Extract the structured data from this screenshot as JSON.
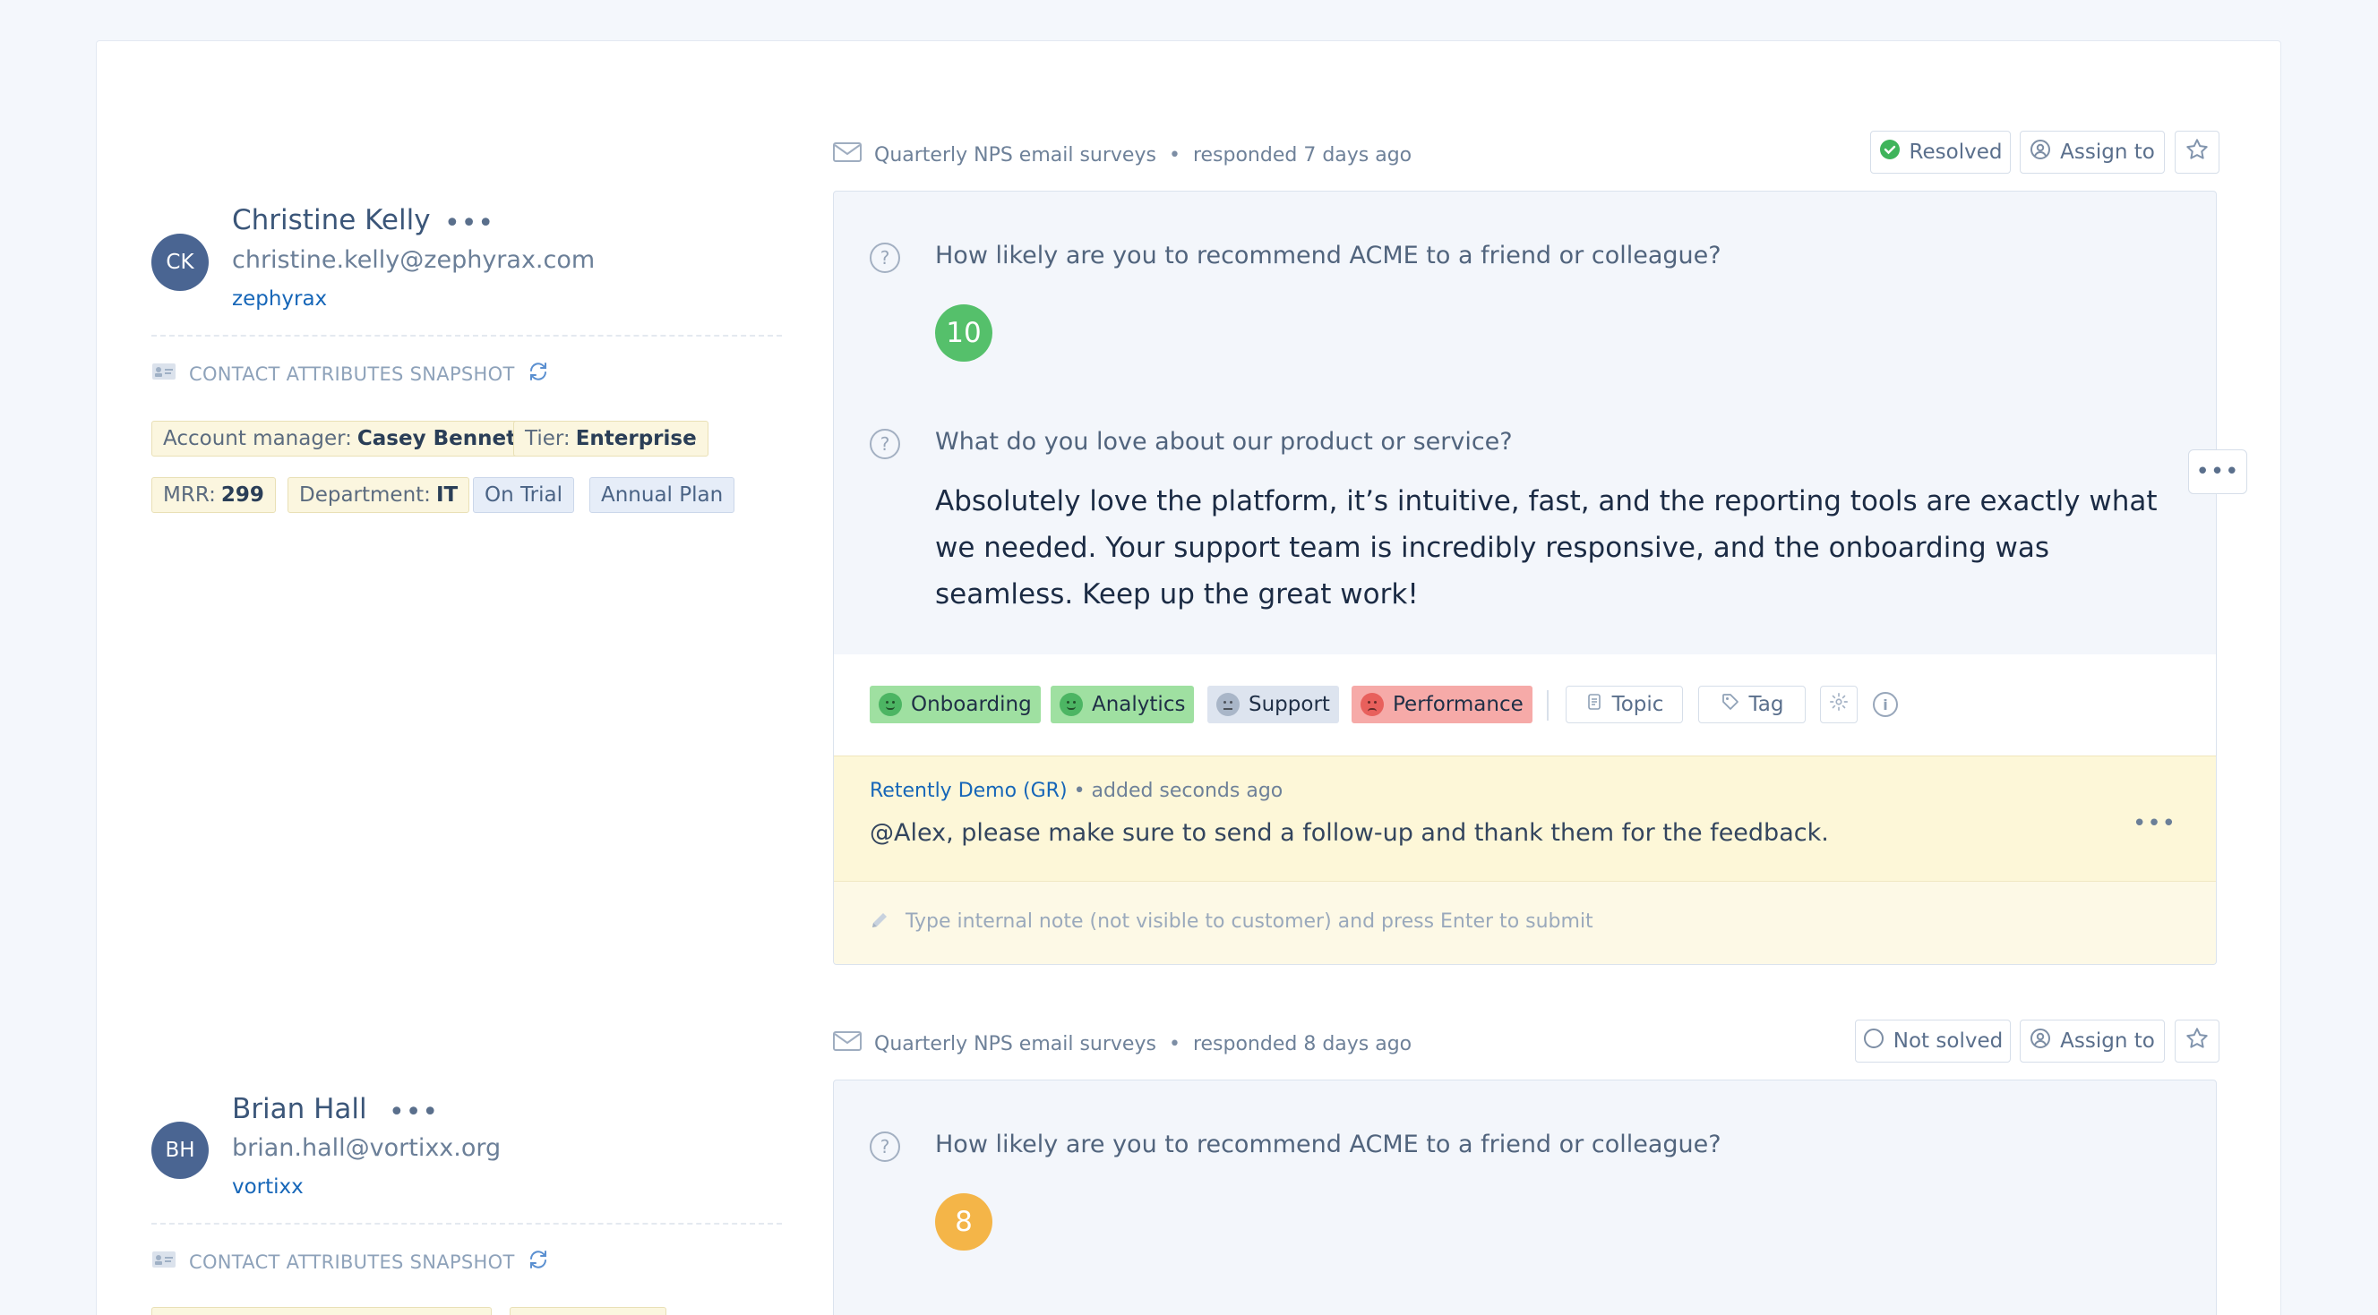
{
  "contacts": [
    {
      "initials": "CK",
      "name": "Christine Kelly",
      "email": "christine.kelly@zephyrax.com",
      "company": "zephyrax",
      "more": "•••",
      "snapshot_label": "CONTACT ATTRIBUTES SNAPSHOT",
      "attributes": [
        {
          "key": "Account manager:",
          "value": "Casey Bennett"
        },
        {
          "key": "Tier:",
          "value": "Enterprise"
        },
        {
          "key": "MRR:",
          "value": "299"
        },
        {
          "key": "Department:",
          "value": "IT"
        }
      ],
      "tags": [
        "On Trial",
        "Annual Plan"
      ]
    },
    {
      "initials": "BH",
      "name": "Brian Hall",
      "email": "brian.hall@vortixx.org",
      "company": "vortixx",
      "more": "•••",
      "snapshot_label": "CONTACT ATTRIBUTES SNAPSHOT"
    }
  ],
  "responses": [
    {
      "channel": "Quarterly NPS email surveys",
      "separator": "•",
      "responded": "responded 7 days ago",
      "status_label": "Resolved",
      "assign_label": "Assign to",
      "question1": "How likely are you to recommend ACME to a friend or colleague?",
      "score": "10",
      "question2": "What do you love about our product or service?",
      "answer": "Absolutely love the platform, it’s intuitive, fast, and the reporting tools are exactly what we needed. Your support team is incredibly responsive, and the onboarding was seamless. Keep up the great work!",
      "topics": [
        {
          "label": "Onboarding",
          "sentiment": "positive"
        },
        {
          "label": "Analytics",
          "sentiment": "positive"
        },
        {
          "label": "Support",
          "sentiment": "neutral"
        },
        {
          "label": "Performance",
          "sentiment": "negative"
        }
      ],
      "topic_button": "Topic",
      "tag_button": "Tag",
      "note": {
        "author": "Retently Demo (GR)",
        "time": "• added seconds ago",
        "text": "@Alex, please make sure to send a follow-up and thank them for the feedback."
      },
      "note_placeholder": "Type internal note (not visible to customer) and press Enter to submit"
    },
    {
      "channel": "Quarterly NPS email surveys",
      "separator": "•",
      "responded": "responded 8 days ago",
      "status_label": "Not solved",
      "assign_label": "Assign to",
      "question1": "How likely are you to recommend ACME to a friend or colleague?",
      "score": "8"
    }
  ],
  "colors": {
    "score_promoter": "#55c06b",
    "score_passive": "#f4b548",
    "positive": "#9fe0a1",
    "neutral": "#dde4ef",
    "negative": "#f6aaa8",
    "resolved": "#3fb45b",
    "link": "#1666b8"
  }
}
